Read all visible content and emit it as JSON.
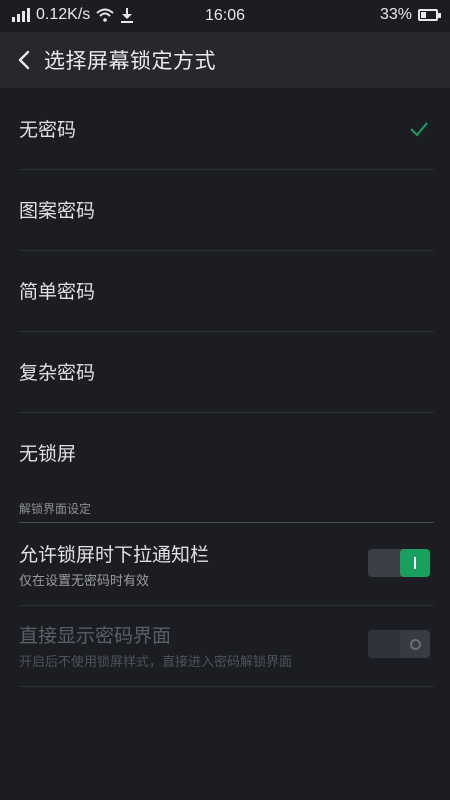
{
  "status_bar": {
    "network_speed": "0.12K/s",
    "time": "16:06",
    "battery_percent": "33%",
    "battery_level": 0.33
  },
  "app_bar": {
    "title": "选择屏幕锁定方式"
  },
  "lock_options": [
    {
      "label": "无密码",
      "selected": true
    },
    {
      "label": "图案密码",
      "selected": false
    },
    {
      "label": "简单密码",
      "selected": false
    },
    {
      "label": "复杂密码",
      "selected": false
    },
    {
      "label": "无锁屏",
      "selected": false
    }
  ],
  "section": {
    "header": "解锁界面设定"
  },
  "settings": [
    {
      "title": "允许锁屏时下拉通知栏",
      "subtitle": "仅在设置无密码时有效",
      "enabled": true,
      "toggle_on": true
    },
    {
      "title": "直接显示密码界面",
      "subtitle": "开启后不使用锁屏样式，直接进入密码解锁界面",
      "enabled": false,
      "toggle_on": false
    }
  ],
  "colors": {
    "accent": "#1aa05e",
    "background": "#1b1d22",
    "app_bar": "#26282d"
  }
}
